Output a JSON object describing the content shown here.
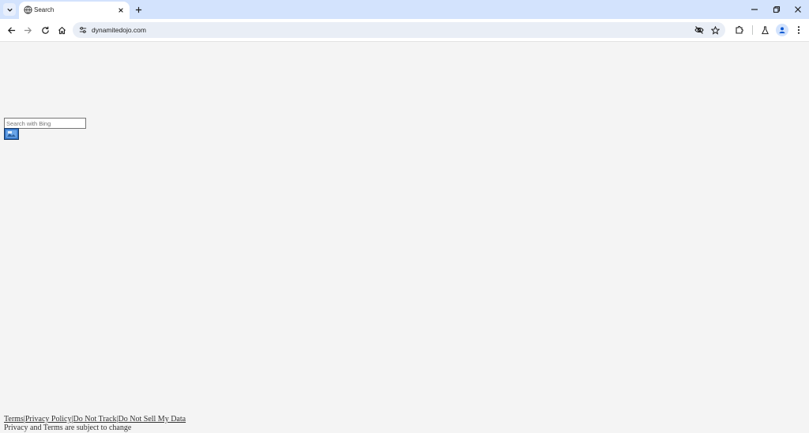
{
  "browser": {
    "tab": {
      "title": "Search",
      "favicon": "globe-icon"
    },
    "address_bar": {
      "url": "dynamitedojo.com"
    },
    "icons": {
      "tab_search": "chevron-down-icon",
      "tab_close": "close-icon",
      "new_tab": "plus-icon",
      "minimize": "minimize-icon",
      "restore": "restore-icon",
      "close_window": "close-icon",
      "back": "arrow-left-icon",
      "forward": "arrow-right-icon",
      "reload": "reload-icon",
      "home": "home-icon",
      "site_info": "tune-icon",
      "eye_off": "eye-off-icon",
      "bookmark": "star-icon",
      "extensions": "puzzle-icon",
      "labs": "flask-icon",
      "profile": "person-icon",
      "menu": "more-vertical-icon"
    },
    "colors": {
      "tabstrip": "#d3e3fd",
      "omnibox": "#e9eef6"
    }
  },
  "page": {
    "search": {
      "placeholder": "Search with Bing",
      "value": "",
      "submit_icon": "bing-search-icon"
    },
    "footer": {
      "links": [
        "Terms",
        "Privacy Policy",
        "Do Not Track",
        "Do Not Sell My Data"
      ],
      "separator": "|",
      "note": "Privacy and Terms are subject to change"
    },
    "colors": {
      "background": "#f4f4f4",
      "submit_button": "#2f70c4"
    }
  }
}
